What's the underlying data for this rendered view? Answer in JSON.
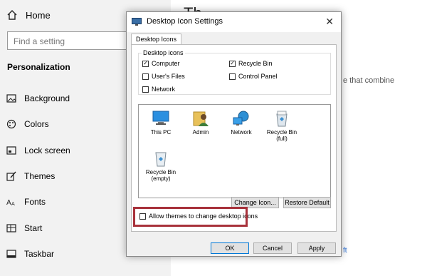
{
  "sidebar": {
    "home_label": "Home",
    "search_placeholder": "Find a setting",
    "section_title": "Personalization",
    "items": [
      {
        "label": "Background"
      },
      {
        "label": "Colors"
      },
      {
        "label": "Lock screen"
      },
      {
        "label": "Themes"
      },
      {
        "label": "Fonts"
      },
      {
        "label": "Start"
      },
      {
        "label": "Taskbar"
      }
    ]
  },
  "background": {
    "title_fragment": "Th",
    "text_fragment": "e that combine",
    "link_fragment": "ft"
  },
  "dialog": {
    "title": "Desktop Icon Settings",
    "close_glyph": "✕",
    "tab_label": "Desktop Icons",
    "group_title": "Desktop icons",
    "checkboxes": {
      "computer": {
        "label": "Computer",
        "checked": true
      },
      "recycle_bin": {
        "label": "Recycle Bin",
        "checked": true
      },
      "users_files": {
        "label": "User's Files",
        "checked": false
      },
      "control_panel": {
        "label": "Control Panel",
        "checked": false
      },
      "network": {
        "label": "Network",
        "checked": false
      }
    },
    "icons": [
      {
        "label": "This PC",
        "icon": "computer-icon"
      },
      {
        "label": "Admin",
        "icon": "user-folder-icon"
      },
      {
        "label": "Network",
        "icon": "network-icon"
      },
      {
        "label": "Recycle Bin\n(full)",
        "icon": "recycle-bin-full-icon"
      },
      {
        "label": "Recycle Bin\n(empty)",
        "icon": "recycle-bin-empty-icon"
      }
    ],
    "change_icon_label": "Change Icon...",
    "restore_default_label": "Restore Default",
    "allow_themes_label": "Allow themes to change desktop icons",
    "allow_themes_checked": false,
    "ok_label": "OK",
    "cancel_label": "Cancel",
    "apply_label": "Apply",
    "check_glyph": "✓"
  },
  "colors": {
    "highlight": "#a8323b",
    "link": "#2a6fd6",
    "primary_button_border": "#0078d7"
  }
}
